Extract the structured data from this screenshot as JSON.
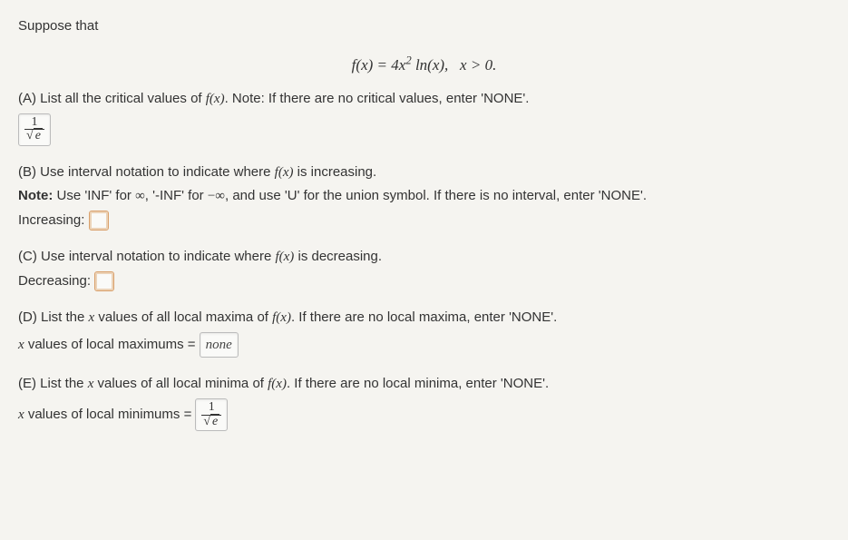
{
  "intro": "Suppose that",
  "equation": {
    "lhs": "f(x) = 4x",
    "exp": "2",
    "mid": " ln(x),",
    "domain_prefix": "   x > 0.",
    "full": "f(x) = 4x² ln(x),   x > 0."
  },
  "parts": {
    "A": {
      "label": "(A) List all the critical values of ",
      "fn": "f(x)",
      "tail": ". Note: If there are no critical values, enter 'NONE'.",
      "answer_num": "1",
      "answer_den_rad": "e"
    },
    "B": {
      "line1a": "(B) Use interval notation to indicate where ",
      "fn": "f(x)",
      "line1b": " is increasing.",
      "note_bold": "Note:",
      "note_rest_a": " Use 'INF' for ",
      "inf": "∞",
      "note_rest_b": ", '-INF' for ",
      "ninf": "−∞",
      "note_rest_c": ", and use 'U' for the union symbol. If there is no interval, enter 'NONE'.",
      "label": "Increasing:"
    },
    "C": {
      "line1a": "(C) Use interval notation to indicate where ",
      "fn": "f(x)",
      "line1b": " is decreasing.",
      "label": "Decreasing:"
    },
    "D": {
      "line1a": "(D) List the ",
      "x": "x",
      "line1b": " values of all local maxima of ",
      "fn": "f(x)",
      "line1c": ". If there are no local maxima, enter 'NONE'.",
      "label_a": "x",
      "label_b": " values of local maximums = ",
      "answer": "none"
    },
    "E": {
      "line1a": "(E) List the ",
      "x": "x",
      "line1b": " values of all local minima of ",
      "fn": "f(x)",
      "line1c": ". If there are no local minima, enter 'NONE'.",
      "label_a": "x",
      "label_b": " values of local minimums = ",
      "answer_num": "1",
      "answer_den_rad": "e"
    }
  }
}
